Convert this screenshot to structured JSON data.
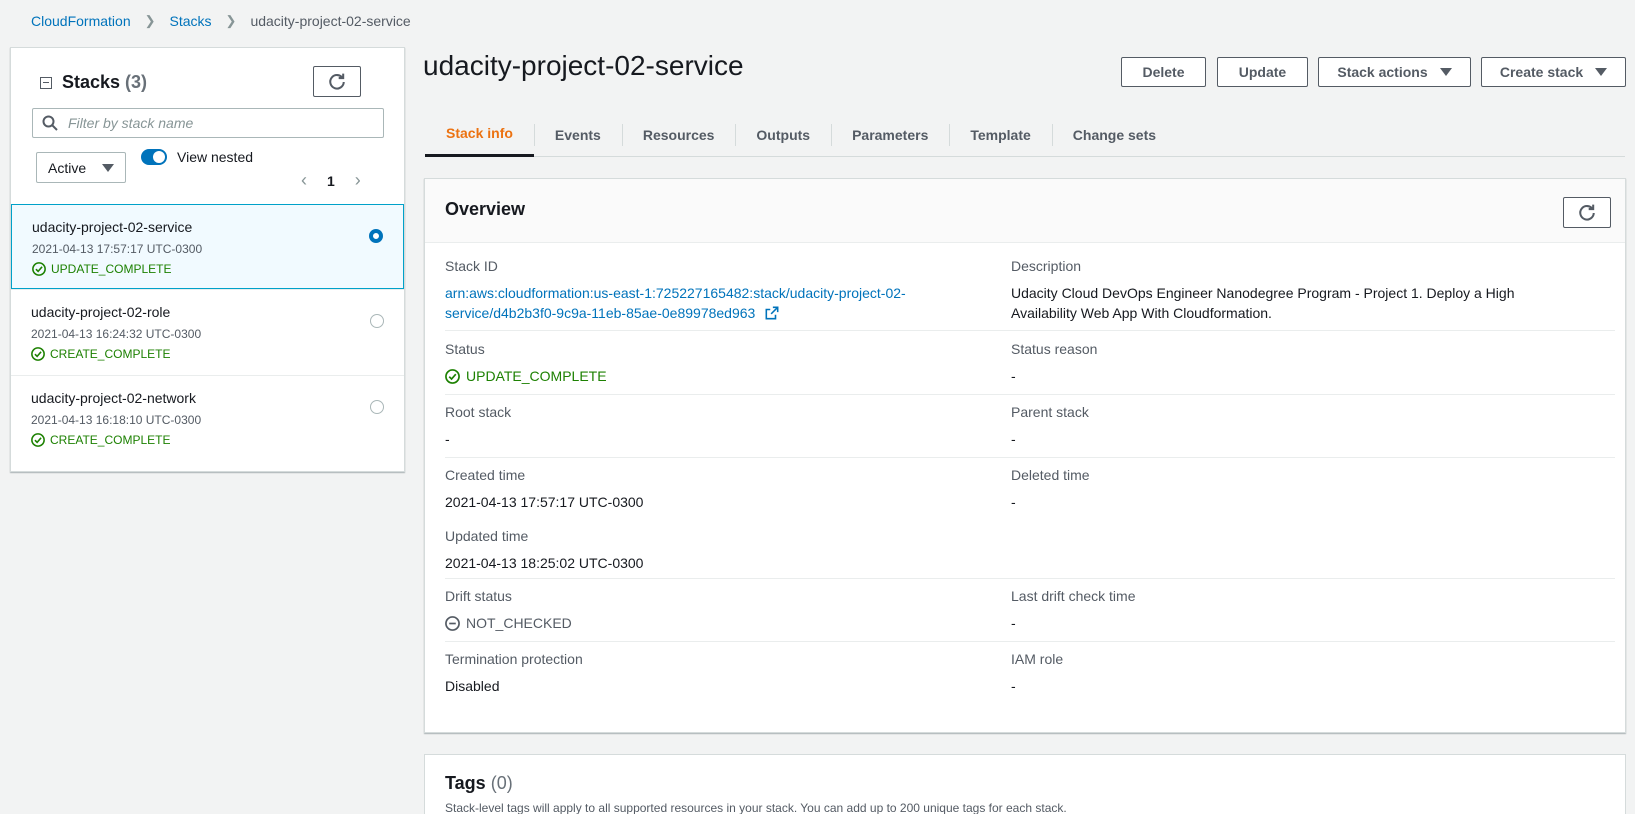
{
  "breadcrumb": {
    "root": "CloudFormation",
    "stacks": "Stacks",
    "current": "udacity-project-02-service"
  },
  "left_panel": {
    "title": "Stacks",
    "count": "(3)",
    "search_placeholder": "Filter by stack name",
    "filter_value": "Active",
    "toggle_label": "View nested",
    "page": "1",
    "stacks": [
      {
        "name": "udacity-project-02-service",
        "time": "2021-04-13 17:57:17 UTC-0300",
        "status": "UPDATE_COMPLETE",
        "selected": true
      },
      {
        "name": "udacity-project-02-role",
        "time": "2021-04-13 16:24:32 UTC-0300",
        "status": "CREATE_COMPLETE",
        "selected": false
      },
      {
        "name": "udacity-project-02-network",
        "time": "2021-04-13 16:18:10 UTC-0300",
        "status": "CREATE_COMPLETE",
        "selected": false
      }
    ]
  },
  "main": {
    "title": "udacity-project-02-service",
    "buttons": {
      "delete": "Delete",
      "update": "Update",
      "stack_actions": "Stack actions",
      "create_stack": "Create stack"
    },
    "tabs": [
      "Stack info",
      "Events",
      "Resources",
      "Outputs",
      "Parameters",
      "Template",
      "Change sets"
    ],
    "overview": {
      "title": "Overview",
      "stack_id_label": "Stack ID",
      "stack_id_line1": "arn:aws:cloudformation:us-east-1:725227165482:stack/udacity-project-02-",
      "stack_id_line2": "service/d4b2b3f0-9c9a-11eb-85ae-0e89978ed963",
      "description_label": "Description",
      "description_line1": "Udacity Cloud DevOps Engineer Nanodegree Program - Project 1. Deploy a High",
      "description_line2": "Availability Web App With Cloudformation.",
      "status_label": "Status",
      "status_value": "UPDATE_COMPLETE",
      "status_reason_label": "Status reason",
      "status_reason_value": "-",
      "root_stack_label": "Root stack",
      "root_stack_value": "-",
      "parent_stack_label": "Parent stack",
      "parent_stack_value": "-",
      "created_label": "Created time",
      "created_value": "2021-04-13 17:57:17 UTC-0300",
      "deleted_label": "Deleted time",
      "deleted_value": "-",
      "updated_label": "Updated time",
      "updated_value": "2021-04-13 18:25:02 UTC-0300",
      "drift_label": "Drift status",
      "drift_value": "NOT_CHECKED",
      "last_drift_label": "Last drift check time",
      "last_drift_value": "-",
      "termination_label": "Termination protection",
      "termination_value": "Disabled",
      "iam_label": "IAM role",
      "iam_value": "-"
    },
    "tags": {
      "title": "Tags",
      "count": "(0)",
      "description": "Stack-level tags will apply to all supported resources in your stack. You can add up to 200 unique tags for each stack."
    }
  },
  "colors": {
    "link": "#0073bb",
    "success": "#1d8102",
    "active_tab": "#ec7211",
    "selected_bg": "#f1faff"
  }
}
